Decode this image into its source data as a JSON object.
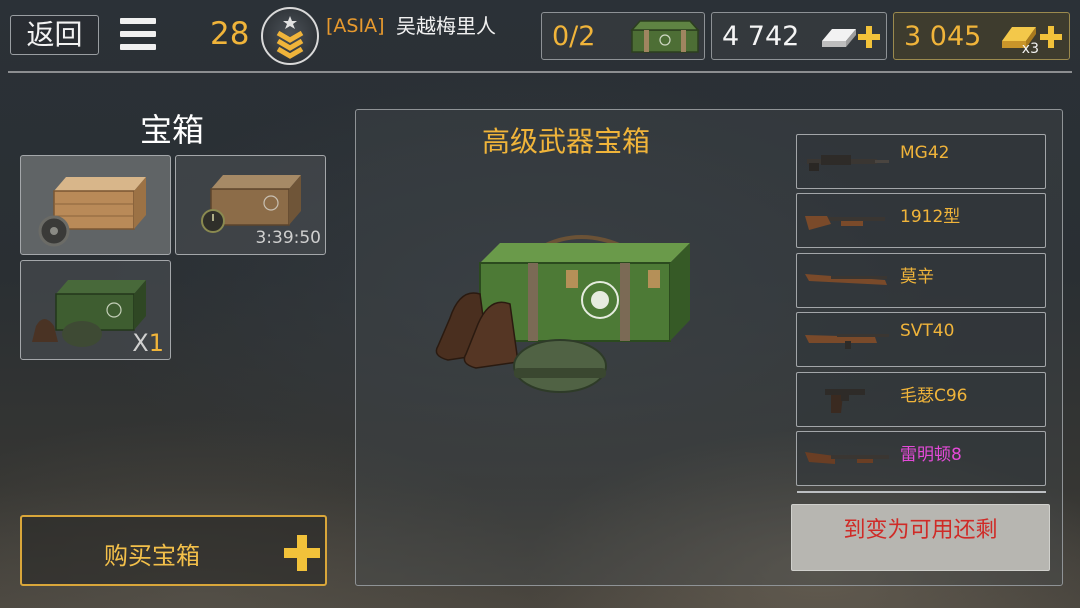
{
  "header": {
    "back_label": "返回",
    "level": "28",
    "player_tag": "[ASIA]",
    "player_name": "吴越梅里人",
    "chest_counter": "0/2",
    "silver": "4 742",
    "gold": "3 045",
    "gold_multiplier": "x3"
  },
  "left_panel": {
    "title": "宝箱",
    "slots": [
      {
        "type": "wooden-chest-with-ammo"
      },
      {
        "type": "wooden-chest-timed",
        "timer": "3:39:50"
      },
      {
        "type": "green-weapon-chest",
        "count_prefix": "X",
        "count": "1"
      }
    ],
    "buy_label": "购买宝箱"
  },
  "main_panel": {
    "title": "高级武器宝箱",
    "weapons": [
      {
        "name": "MG42",
        "rarity": "common"
      },
      {
        "name": "1912型",
        "rarity": "common"
      },
      {
        "name": "莫辛",
        "rarity": "common"
      },
      {
        "name": "SVT40",
        "rarity": "common"
      },
      {
        "name": "毛瑟C96",
        "rarity": "common"
      },
      {
        "name": "雷明顿8",
        "rarity": "epic"
      }
    ],
    "unavailable_label": "到变为可用还剩"
  },
  "colors": {
    "accent_gold": "#f0b43a",
    "epic_purple": "#e44ad8",
    "warning_red": "#cf2b27"
  }
}
